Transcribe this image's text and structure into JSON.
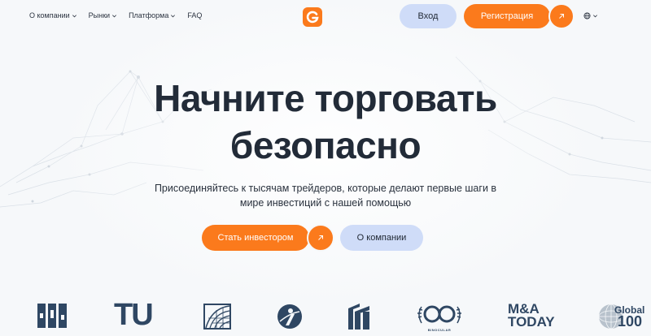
{
  "header": {
    "nav": [
      {
        "label": "О компании"
      },
      {
        "label": "Рынки"
      },
      {
        "label": "Платформа"
      },
      {
        "label": "FAQ"
      }
    ],
    "logo_icon": "brand-g-logo-icon",
    "login_label": "Вход",
    "register_label": "Регистрация",
    "language_icon": "globe-icon"
  },
  "hero": {
    "title_line1": "Начните торговать",
    "title_line2": "безопасно",
    "subtitle_line1": "Присоединяйтесь к тысячам трейдеров, которые делают первые шаги в",
    "subtitle_line2": "мире инвестиций с нашей помощью",
    "primary_cta": "Стать инвестором",
    "secondary_cta": "О компании"
  },
  "partners": {
    "tu": "TU",
    "ma_line1": "M&A",
    "ma_line2": "TODAY",
    "global_line1": "Global",
    "global_line2": "100",
    "binocular_caption": "BINOCULAR"
  },
  "colors": {
    "accent": "#fb7a1c",
    "secondary_button": "#cfdcf8",
    "partner_logo": "#2f4763",
    "background": "#f6f8fa"
  }
}
